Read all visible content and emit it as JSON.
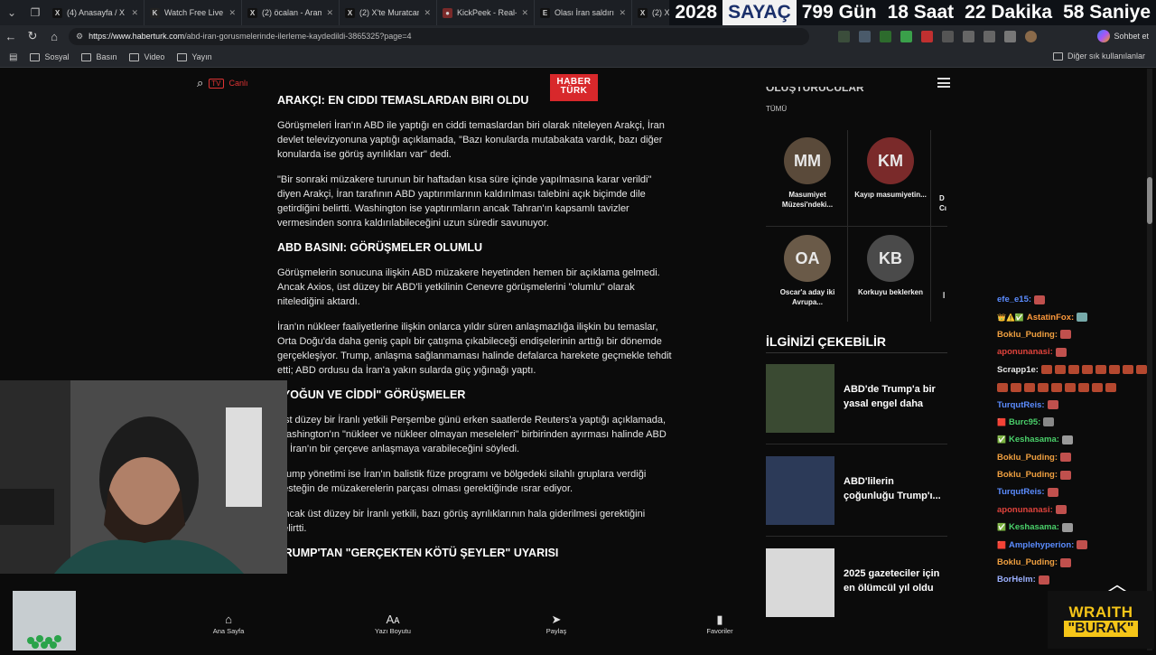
{
  "browser": {
    "tabs": [
      {
        "title": "(4) Anasayfa / X",
        "icon": "x-logo-icon",
        "icon_glyph": "X"
      },
      {
        "title": "Watch Free Live",
        "icon": "kick-icon",
        "icon_glyph": "K"
      },
      {
        "title": "(2) öcalan - Arama /",
        "icon": "x-logo-icon",
        "icon_glyph": "X"
      },
      {
        "title": "(2) X'te Muratcan A",
        "icon": "x-logo-icon",
        "icon_glyph": "X"
      },
      {
        "title": "KickPeek - Real-tim",
        "icon": "kickpeek-icon",
        "icon_glyph": "●"
      },
      {
        "title": "Olası İran saldırısı y",
        "icon": "news-icon",
        "icon_glyph": "E"
      },
      {
        "title": "(2) X",
        "icon": "x-logo-icon",
        "icon_glyph": "X"
      }
    ],
    "url_domain": "https://www.haberturk.com",
    "url_path": "/abd-iran-gorusmelerinde-ilerleme-kaydedildi-3865325?page=4",
    "chat_button": "Sohbet et",
    "bookmarks": [
      "Sosyal",
      "Basın",
      "Video",
      "Yayın"
    ],
    "bookmarks_right": "Diğer sık kullanılanlar"
  },
  "overlay_counter": {
    "year": "2028",
    "label": "SAYAÇ",
    "days": "799 Gün",
    "hours": "18 Saat",
    "minutes": "22 Dakika",
    "seconds": "58 Saniye"
  },
  "site": {
    "live_label": "Canlı",
    "logo_line1": "HABER",
    "logo_line2": "TÜRK"
  },
  "article": {
    "h1": "ARAKÇI: EN CIDDI TEMASLARDAN BIRI OLDU",
    "p1": "Görüşmeleri İran'ın ABD ile yaptığı en ciddi temaslardan biri olarak niteleyen Arakçi, İran devlet televizyonuna yaptığı açıklamada, \"Bazı konularda mutabakata vardık, bazı diğer konularda ise görüş ayrılıkları var\" dedi.",
    "p2": "\"Bir sonraki müzakere turunun bir haftadan kısa süre içinde yapılmasına karar verildi\" diyen Arakçi, İran tarafının ABD yaptırımlarının kaldırılması talebini açık biçimde dile getirdiğini belirtti. Washington ise yaptırımların ancak Tahran'ın kapsamlı tavizler vermesinden sonra kaldırılabileceğini uzun süredir savunuyor.",
    "h2": "ABD BASINI: GÖRÜŞMELER OLUMLU",
    "p3": "Görüşmelerin sonucuna ilişkin ABD müzakere heyetinden hemen bir açıklama gelmedi. Ancak Axios, üst düzey bir ABD'li yetkilinin Cenevre görüşmelerini \"olumlu\" olarak nitelediğini aktardı.",
    "p4": "İran'ın nükleer faaliyetlerine ilişkin onlarca yıldır süren anlaşmazlığa ilişkin bu temaslar, Orta Doğu'da daha geniş çaplı bir çatışma çıkabileceği endişelerinin arttığı bir dönemde gerçekleşiyor. Trump, anlaşma sağlanmaması halinde defalarca harekete geçmekle tehdit etti; ABD ordusu da İran'a yakın sularda güç yığınağı yaptı.",
    "h3": "\"YOĞUN VE CİDDİ\" GÖRÜŞMELER",
    "p5": "Üst düzey bir İranlı yetkili Perşembe günü erken saatlerde Reuters'a yaptığı açıklamada, Washington'ın \"nükleer ve nükleer olmayan meseleleri\" birbirinden ayırması halinde ABD ile İran'ın bir çerçeve anlaşmaya varabileceğini söyledi.",
    "p6": "Trump yönetimi ise İran'ın balistik füze programı ve bölgedeki silahlı gruplara verdiği desteğin de müzakerelerin parçası olması gerektiğinde ısrar ediyor.",
    "p7": "Ancak üst düzey bir İranlı yetkili, bazı görüş ayrılıklarının hala giderilmesi gerektiğini belirtti.",
    "h4": "TRUMP'TAN \"GERÇEKTEN KÖTÜ ŞEYLER\" UYARISI"
  },
  "sidebar": {
    "section_title_cut": "OLUŞTURUCULAR",
    "all_label": "TÜMÜ",
    "people": [
      {
        "name": "Masumiyet Müzesi'ndeki...",
        "initials": "MM",
        "color": "#5a4a3a"
      },
      {
        "name": "Kayıp masumiyetin...",
        "initials": "KM",
        "color": "#7a2a2a"
      },
      {
        "name": "Oscar'a aday iki Avrupa...",
        "initials": "OA",
        "color": "#6a5a48"
      },
      {
        "name": "Korkuyu beklerken",
        "initials": "KB",
        "color": "#4a4a4a"
      }
    ],
    "partial_right_1": "D\nCı",
    "partial_right_2": "İ",
    "interest_title": "İLGİNİZİ ÇEKEBİLİR",
    "news": [
      {
        "title": "ABD'de Trump'a bir yasal engel daha",
        "thumb_color": "#3a4a32"
      },
      {
        "title": "ABD'lilerin çoğunluğu Trump'ı...",
        "thumb_color": "#2c3a58"
      },
      {
        "title": "2025 gazeteciler için en ölümcül yıl oldu",
        "thumb_color": "#d9d9d9"
      }
    ]
  },
  "bottom_nav": [
    {
      "label": "Ana Sayfa",
      "icon": "home-icon",
      "glyph": "⌂"
    },
    {
      "label": "Yazı Boyutu",
      "icon": "font-size-icon",
      "glyph": "Aᴀ"
    },
    {
      "label": "Paylaş",
      "icon": "share-icon",
      "glyph": "➤"
    },
    {
      "label": "Favoriler",
      "icon": "bookmark-icon",
      "glyph": "▮"
    }
  ],
  "chat": [
    {
      "user": "efe_e15:",
      "color": "#5b8cff",
      "badges": "",
      "emotes": 1,
      "emote_color": "#c0504d"
    },
    {
      "user": "AstatinFox:",
      "color": "#ff9a3c",
      "badges": "👑⚠️✅",
      "emotes": 1,
      "emote_color": "#7aa"
    },
    {
      "user": "Boklu_Puding:",
      "color": "#f0a040",
      "badges": "",
      "emotes": 1,
      "emote_color": "#c0504d"
    },
    {
      "user": "aponunanasi:",
      "color": "#e0433c",
      "badges": "",
      "emotes": 1,
      "emote_color": "#c0504d"
    },
    {
      "user": "Scrapp1e:",
      "color": "#e8e8e8",
      "badges": "",
      "emotes": 8,
      "emote_color": "#b5482f"
    },
    {
      "user": "",
      "color": "#e8e8e8",
      "badges": "",
      "emotes": 9,
      "emote_color": "#b5482f"
    },
    {
      "user": "TurqutReis:",
      "color": "#5b8cff",
      "badges": "",
      "emotes": 1,
      "emote_color": "#c0504d"
    },
    {
      "user": "Burc95:",
      "color": "#4ad06a",
      "badges": "🟥",
      "emotes": 1,
      "emote_color": "#888"
    },
    {
      "user": "Keshasama:",
      "color": "#4ad06a",
      "badges": "✅",
      "emotes": 1,
      "emote_color": "#999"
    },
    {
      "user": "Boklu_Puding:",
      "color": "#f0a040",
      "badges": "",
      "emotes": 1,
      "emote_color": "#c0504d"
    },
    {
      "user": "Boklu_Puding:",
      "color": "#f0a040",
      "badges": "",
      "emotes": 1,
      "emote_color": "#c0504d"
    },
    {
      "user": "TurqutReis:",
      "color": "#5b8cff",
      "badges": "",
      "emotes": 1,
      "emote_color": "#c0504d"
    },
    {
      "user": "aponunanasi:",
      "color": "#e0433c",
      "badges": "",
      "emotes": 1,
      "emote_color": "#c0504d"
    },
    {
      "user": "Keshasama:",
      "color": "#4ad06a",
      "badges": "✅",
      "emotes": 1,
      "emote_color": "#999"
    },
    {
      "user": "Amplehyperion:",
      "color": "#5b8cff",
      "badges": "🟥",
      "emotes": 1,
      "emote_color": "#c0504d"
    },
    {
      "user": "Boklu_Puding:",
      "color": "#f0a040",
      "badges": "",
      "emotes": 1,
      "emote_color": "#c0504d"
    },
    {
      "user": "BorHelm:",
      "color": "#9bb0ff",
      "badges": "",
      "emotes": 1,
      "emote_color": "#c0504d"
    }
  ],
  "stream_overlay": {
    "brand_line1": "WRAITH",
    "brand_line2": "\"BURAK\""
  }
}
